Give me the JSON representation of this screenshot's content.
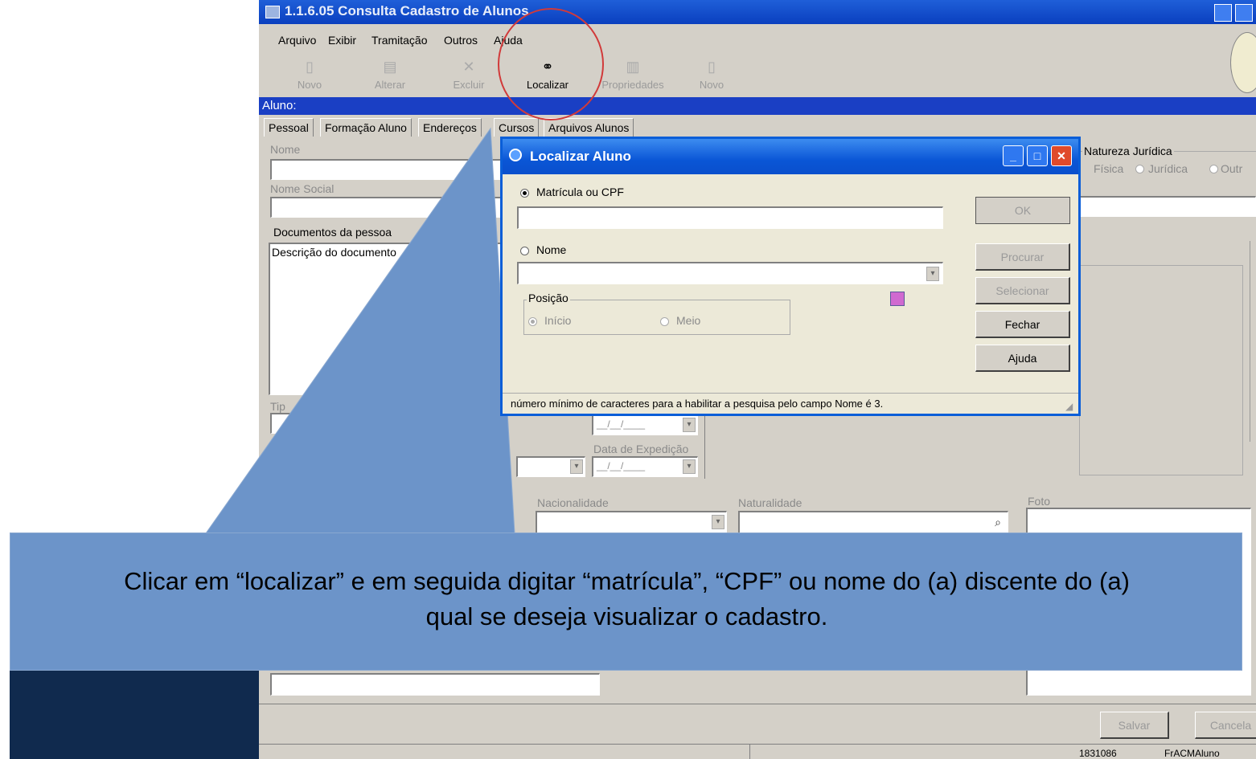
{
  "window": {
    "title": "1.1.6.05 Consulta Cadastro de Alunos",
    "menu": [
      "Arquivo",
      "Exibir",
      "Tramitação",
      "Outros",
      "Ajuda"
    ],
    "toolbar": [
      {
        "label": "Novo",
        "icon": "new-document-icon"
      },
      {
        "label": "Alterar",
        "icon": "edit-icon"
      },
      {
        "label": "Excluir",
        "icon": "delete-icon"
      },
      {
        "label": "Localizar",
        "icon": "binoculars-icon"
      },
      {
        "label": "Propriedades",
        "icon": "properties-icon"
      },
      {
        "label": "Novo",
        "icon": "new-document-icon"
      }
    ],
    "section": "Aluno:",
    "tabs": [
      "Pessoal",
      "Formação Aluno",
      "Endereços",
      "Cursos",
      "Arquivos Alunos"
    ],
    "labels": {
      "nome": "Nome",
      "nome_social": "Nome Social",
      "documentos": "Documentos da pessoa",
      "descricao": "Descrição do documento",
      "tipo": "Tip",
      "natureza": "Natureza Jurídica",
      "fisica": "Física",
      "juridica": "Jurídica",
      "outra": "Outr",
      "data_expedicao": "Data de Expedição",
      "nacionalidade": "Nacionalidade",
      "naturalidade": "Naturalidade",
      "foto": "Foto",
      "date_mask": "__/__/____"
    },
    "buttons": {
      "salvar": "Salvar",
      "cancelar": "Cancela"
    },
    "status": {
      "code": "1831086",
      "form": "FrACMAluno"
    }
  },
  "dialog": {
    "title": "Localizar Aluno",
    "option_matricula": "Matrícula ou CPF",
    "option_nome": "Nome",
    "posicao_label": "Posição",
    "posicao_inicio": "Início",
    "posicao_meio": "Meio",
    "buttons": {
      "ok": "OK",
      "procurar": "Procurar",
      "selecionar": "Selecionar",
      "fechar": "Fechar",
      "ajuda": "Ajuda"
    },
    "hint": "número mínimo de caracteres para a habilitar a pesquisa pelo campo Nome é 3."
  },
  "callout": {
    "line1": "Clicar em “localizar” e em seguida digitar “matrícula”, “CPF” ou nome do (a) discente do (a)",
    "line2": "qual se deseja visualizar o cadastro."
  },
  "colors": {
    "title_blue": "#0a3fbf",
    "section_blue": "#1a3fc4",
    "callout": "#6c94c9",
    "navy": "#102a4e",
    "highlight_circle": "#d13a3a"
  }
}
